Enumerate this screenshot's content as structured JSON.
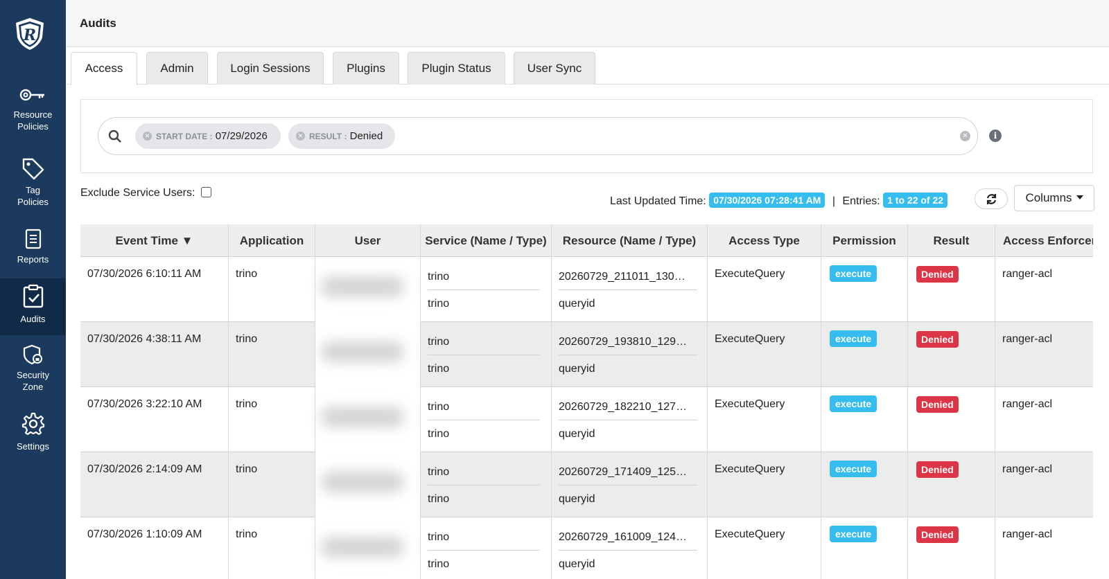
{
  "header": {
    "title": "Audits"
  },
  "sidebar": {
    "items": [
      {
        "label_line1": "Resource",
        "label_line2": "Policies",
        "icon": "key-icon"
      },
      {
        "label_line1": "Tag",
        "label_line2": "Policies",
        "icon": "tag-icon"
      },
      {
        "label_line1": "Reports",
        "label_line2": "",
        "icon": "report-icon"
      },
      {
        "label_line1": "Audits",
        "label_line2": "",
        "icon": "clipboard-check-icon",
        "active": true
      },
      {
        "label_line1": "Security",
        "label_line2": "Zone",
        "icon": "security-zone-icon"
      },
      {
        "label_line1": "Settings",
        "label_line2": "",
        "icon": "gear-icon"
      }
    ]
  },
  "tabs": [
    "Access",
    "Admin",
    "Login Sessions",
    "Plugins",
    "Plugin Status",
    "User Sync"
  ],
  "search": {
    "chips": [
      {
        "key": "START DATE :",
        "value": "07/29/2026"
      },
      {
        "key": "RESULT :",
        "value": "Denied"
      }
    ]
  },
  "toolbar": {
    "exclude_label": "Exclude Service Users:",
    "last_updated_label": "Last Updated Time:",
    "last_updated_value": "07/30/2026 07:28:41 AM",
    "separator": "|",
    "entries_label": "Entries:",
    "entries_value": "1 to 22 of 22",
    "columns_label": "Columns"
  },
  "table": {
    "headers": [
      "Event Time ▼",
      "Application",
      "User",
      "Service (Name / Type)",
      "Resource (Name / Type)",
      "Access Type",
      "Permission",
      "Result",
      "Access Enforcer"
    ],
    "rows": [
      {
        "event_time": "07/30/2026 6:10:11 AM",
        "application": "trino",
        "service_name": "trino",
        "service_type": "trino",
        "resource_name": "20260729_211011_130…",
        "resource_type": "queryid",
        "access_type": "ExecuteQuery",
        "permission": "execute",
        "result": "Denied",
        "enforcer": "ranger-acl"
      },
      {
        "event_time": "07/30/2026 4:38:11 AM",
        "application": "trino",
        "service_name": "trino",
        "service_type": "trino",
        "resource_name": "20260729_193810_129…",
        "resource_type": "queryid",
        "access_type": "ExecuteQuery",
        "permission": "execute",
        "result": "Denied",
        "enforcer": "ranger-acl"
      },
      {
        "event_time": "07/30/2026 3:22:10 AM",
        "application": "trino",
        "service_name": "trino",
        "service_type": "trino",
        "resource_name": "20260729_182210_127…",
        "resource_type": "queryid",
        "access_type": "ExecuteQuery",
        "permission": "execute",
        "result": "Denied",
        "enforcer": "ranger-acl"
      },
      {
        "event_time": "07/30/2026 2:14:09 AM",
        "application": "trino",
        "service_name": "trino",
        "service_type": "trino",
        "resource_name": "20260729_171409_125…",
        "resource_type": "queryid",
        "access_type": "ExecuteQuery",
        "permission": "execute",
        "result": "Denied",
        "enforcer": "ranger-acl"
      },
      {
        "event_time": "07/30/2026 1:10:09 AM",
        "application": "trino",
        "service_name": "trino",
        "service_type": "trino",
        "resource_name": "20260729_161009_124…",
        "resource_type": "queryid",
        "access_type": "ExecuteQuery",
        "permission": "execute",
        "result": "Denied",
        "enforcer": "ranger-acl"
      }
    ]
  },
  "colors": {
    "sidebar": "#1b3a5e",
    "sidebar_active": "#102a47",
    "info_badge": "#34bdee",
    "denied_badge": "#dc3545"
  }
}
